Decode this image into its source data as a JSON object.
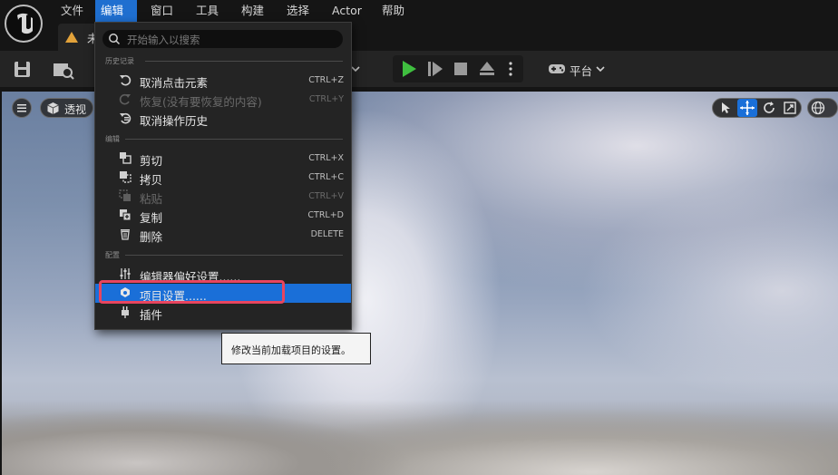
{
  "menubar": {
    "items": [
      "文件",
      "编辑",
      "窗口",
      "工具",
      "构建",
      "选择",
      "Actor",
      "帮助"
    ],
    "active_index": 1
  },
  "tab": {
    "title_partial": "未"
  },
  "toolbar": {
    "platforms_label": "平台"
  },
  "viewport": {
    "perspective_label": "透视"
  },
  "dropdown": {
    "search_placeholder": "开始输入以搜索",
    "sections": {
      "history": "历史记录",
      "edit": "编辑",
      "config": "配置"
    },
    "history_items": [
      {
        "label": "取消点击元素",
        "shortcut": "CTRL+Z",
        "icon": "undo-icon",
        "disabled": false
      },
      {
        "label": "恢复(没有要恢复的内容)",
        "shortcut": "CTRL+Y",
        "icon": "redo-icon",
        "disabled": true
      },
      {
        "label": "取消操作历史",
        "shortcut": "",
        "icon": "history-icon",
        "disabled": false
      }
    ],
    "edit_items": [
      {
        "label": "剪切",
        "shortcut": "CTRL+X",
        "icon": "cut-icon",
        "disabled": false
      },
      {
        "label": "拷贝",
        "shortcut": "CTRL+C",
        "icon": "copy-icon",
        "disabled": false
      },
      {
        "label": "粘贴",
        "shortcut": "CTRL+V",
        "icon": "paste-icon",
        "disabled": true
      },
      {
        "label": "复制",
        "shortcut": "CTRL+D",
        "icon": "duplicate-icon",
        "disabled": false
      },
      {
        "label": "删除",
        "shortcut": "DELETE",
        "icon": "trash-icon",
        "disabled": false
      }
    ],
    "config_items": [
      {
        "label": "编辑器偏好设置......",
        "icon": "sliders-icon"
      },
      {
        "label": "项目设置......",
        "icon": "project-settings-icon",
        "selected": true
      },
      {
        "label": "插件",
        "icon": "plugin-icon"
      }
    ]
  },
  "tooltip": {
    "text": "修改当前加载项目的设置。"
  },
  "colors": {
    "accent": "#1a6fd8",
    "highlight": "#e8455f",
    "play_green": "#3fbf3f"
  }
}
